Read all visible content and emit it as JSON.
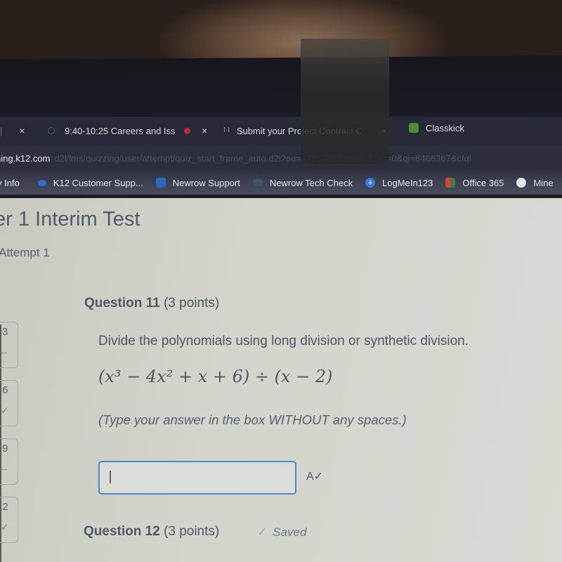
{
  "browser": {
    "tabs": [
      {
        "label": "",
        "close": "×",
        "icon": "tab-icon"
      },
      {
        "label": "9:40-10:25 Careers and Iss",
        "close": "×",
        "icon": "loading-icon",
        "indicator": "recording-dot-icon"
      },
      {
        "label": "Submit your Project Contract C",
        "close": "×",
        "icon": "page-icon"
      },
      {
        "label": "Classkick",
        "icon": "classkick-icon"
      }
    ],
    "address": {
      "host": "ning.k12.com",
      "path": "d2l/lms/quizzing/user/attempt/quiz_start_frame_auto.d2l?ou=1755705&isprv=&drc=0&qi=8466367&cfql"
    },
    "bookmarks": [
      {
        "label": "y Info",
        "icon": "none"
      },
      {
        "label": "K12 Customer Supp...",
        "icon": "k12-icon"
      },
      {
        "label": "Newrow Support",
        "icon": "newrow-icon"
      },
      {
        "label": "Newrow Tech Check",
        "icon": "newrow-tech-icon"
      },
      {
        "label": "LogMeIn123",
        "icon": "logmein-icon"
      },
      {
        "label": "Office 365",
        "icon": "office-icon"
      },
      {
        "label": "Mine",
        "icon": "globe-icon"
      }
    ]
  },
  "page": {
    "title": "er 1 Interim Test",
    "attempt": "Attempt 1",
    "question_nav": [
      {
        "num": "3",
        "status": "--"
      },
      {
        "num": "6",
        "status": "✓"
      },
      {
        "num": "9",
        "status": "--"
      },
      {
        "num": "12",
        "status": "✓"
      }
    ],
    "question": {
      "number_label": "Question 11",
      "points": "(3 points)",
      "text": "Divide the polynomials using long division or synthetic division.",
      "expression": "(x³ − 4x² + x + 6) ÷ (x − 2)",
      "hint": "(Type your answer in the box WITHOUT any spaces.)",
      "answer_value": "",
      "spellcheck_icon": "A✓"
    },
    "next_question": {
      "number_label": "Question 12",
      "points": "(3 points)",
      "status": "Saved",
      "status_icon": "✓"
    }
  },
  "colors": {
    "accent": "#4f86c9",
    "tabbar": "#262a36",
    "page_bg": "#d3d4cc",
    "text": "#4e5866"
  }
}
